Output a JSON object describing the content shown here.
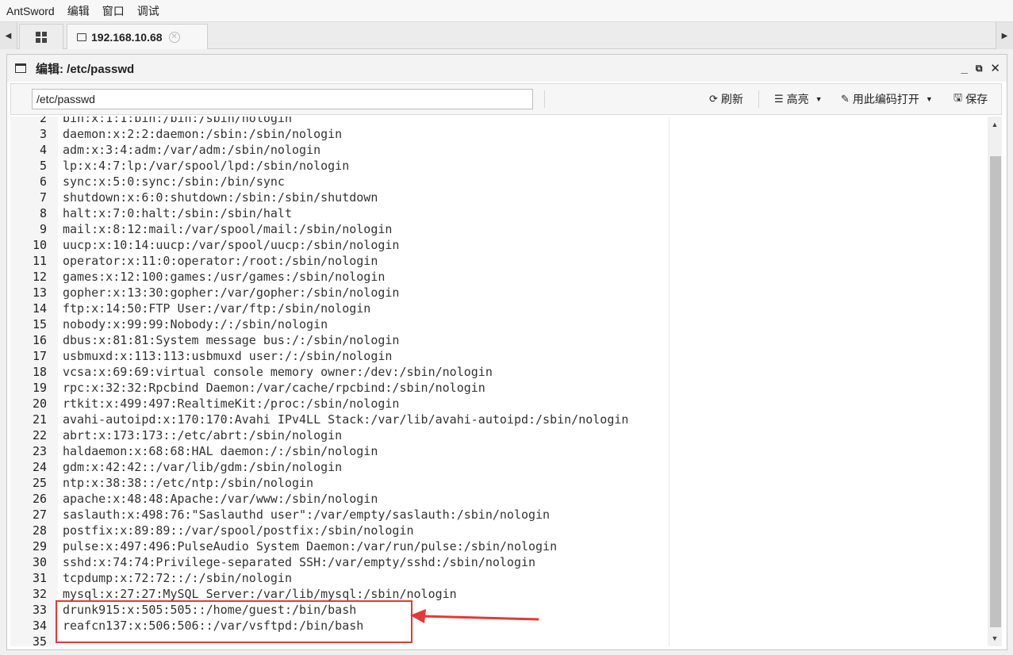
{
  "menubar": {
    "items": [
      "AntSword",
      "编辑",
      "窗口",
      "调试"
    ]
  },
  "tabs": {
    "host_label": "192.168.10.68"
  },
  "window": {
    "title": "编辑: /etc/passwd"
  },
  "toolbar": {
    "path_value": "/etc/passwd",
    "refresh_label": "刷新",
    "highlight_label": "高亮",
    "encoding_label": "用此编码打开",
    "save_label": "保存"
  },
  "editor": {
    "lines": [
      {
        "n": "2",
        "text": "bin:x:1:1:bin:/bin:/sbin/nologin"
      },
      {
        "n": "3",
        "text": "daemon:x:2:2:daemon:/sbin:/sbin/nologin"
      },
      {
        "n": "4",
        "text": "adm:x:3:4:adm:/var/adm:/sbin/nologin"
      },
      {
        "n": "5",
        "text": "lp:x:4:7:lp:/var/spool/lpd:/sbin/nologin"
      },
      {
        "n": "6",
        "text": "sync:x:5:0:sync:/sbin:/bin/sync"
      },
      {
        "n": "7",
        "text": "shutdown:x:6:0:shutdown:/sbin:/sbin/shutdown"
      },
      {
        "n": "8",
        "text": "halt:x:7:0:halt:/sbin:/sbin/halt"
      },
      {
        "n": "9",
        "text": "mail:x:8:12:mail:/var/spool/mail:/sbin/nologin"
      },
      {
        "n": "10",
        "text": "uucp:x:10:14:uucp:/var/spool/uucp:/sbin/nologin"
      },
      {
        "n": "11",
        "text": "operator:x:11:0:operator:/root:/sbin/nologin"
      },
      {
        "n": "12",
        "text": "games:x:12:100:games:/usr/games:/sbin/nologin"
      },
      {
        "n": "13",
        "text": "gopher:x:13:30:gopher:/var/gopher:/sbin/nologin"
      },
      {
        "n": "14",
        "text": "ftp:x:14:50:FTP User:/var/ftp:/sbin/nologin"
      },
      {
        "n": "15",
        "text": "nobody:x:99:99:Nobody:/:/sbin/nologin"
      },
      {
        "n": "16",
        "text": "dbus:x:81:81:System message bus:/:/sbin/nologin"
      },
      {
        "n": "17",
        "text": "usbmuxd:x:113:113:usbmuxd user:/:/sbin/nologin"
      },
      {
        "n": "18",
        "text": "vcsa:x:69:69:virtual console memory owner:/dev:/sbin/nologin"
      },
      {
        "n": "19",
        "text": "rpc:x:32:32:Rpcbind Daemon:/var/cache/rpcbind:/sbin/nologin"
      },
      {
        "n": "20",
        "text": "rtkit:x:499:497:RealtimeKit:/proc:/sbin/nologin"
      },
      {
        "n": "21",
        "text": "avahi-autoipd:x:170:170:Avahi IPv4LL Stack:/var/lib/avahi-autoipd:/sbin/nologin"
      },
      {
        "n": "22",
        "text": "abrt:x:173:173::/etc/abrt:/sbin/nologin"
      },
      {
        "n": "23",
        "text": "haldaemon:x:68:68:HAL daemon:/:/sbin/nologin"
      },
      {
        "n": "24",
        "text": "gdm:x:42:42::/var/lib/gdm:/sbin/nologin"
      },
      {
        "n": "25",
        "text": "ntp:x:38:38::/etc/ntp:/sbin/nologin"
      },
      {
        "n": "26",
        "text": "apache:x:48:48:Apache:/var/www:/sbin/nologin"
      },
      {
        "n": "27",
        "text": "saslauth:x:498:76:\"Saslauthd user\":/var/empty/saslauth:/sbin/nologin"
      },
      {
        "n": "28",
        "text": "postfix:x:89:89::/var/spool/postfix:/sbin/nologin"
      },
      {
        "n": "29",
        "text": "pulse:x:497:496:PulseAudio System Daemon:/var/run/pulse:/sbin/nologin"
      },
      {
        "n": "30",
        "text": "sshd:x:74:74:Privilege-separated SSH:/var/empty/sshd:/sbin/nologin"
      },
      {
        "n": "31",
        "text": "tcpdump:x:72:72::/:/sbin/nologin"
      },
      {
        "n": "32",
        "text": "mysql:x:27:27:MySQL Server:/var/lib/mysql:/sbin/nologin"
      },
      {
        "n": "33",
        "text": "drunk915:x:505:505::/home/guest:/bin/bash"
      },
      {
        "n": "34",
        "text": "reafcn137:x:506:506::/var/vsftpd:/bin/bash"
      },
      {
        "n": "35",
        "text": ""
      }
    ]
  },
  "colors": {
    "annotation": "#e53935"
  }
}
